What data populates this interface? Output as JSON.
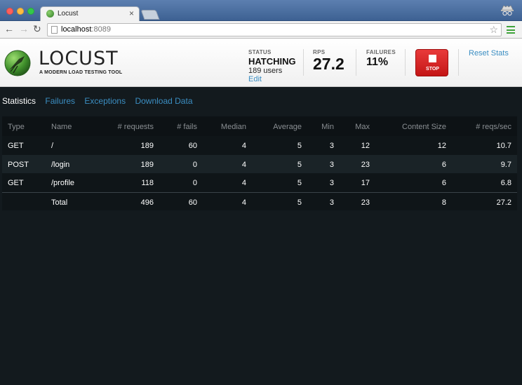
{
  "browser": {
    "tab_title": "Locust",
    "tab_close": "×",
    "url_host": "localhost",
    "url_port": ":8089"
  },
  "app": {
    "logo_text": "LOCUST",
    "logo_subtitle": "A MODERN LOAD TESTING TOOL",
    "status_label": "STATUS",
    "status_value": "HATCHING",
    "users_text": "189 users",
    "edit_label": "Edit",
    "rps_label": "RPS",
    "rps_value": "27.2",
    "failures_label": "FAILURES",
    "failures_value": "11%",
    "stop_label": "STOP",
    "reset_label": "Reset Stats",
    "colors": {
      "accent": "#3b8ec2",
      "stop": "#d42020",
      "background": "#131a1e"
    }
  },
  "tabs": {
    "statistics": "Statistics",
    "failures": "Failures",
    "exceptions": "Exceptions",
    "download": "Download Data"
  },
  "table": {
    "headers": {
      "type": "Type",
      "name": "Name",
      "requests": "# requests",
      "fails": "# fails",
      "median": "Median",
      "average": "Average",
      "min": "Min",
      "max": "Max",
      "content_size": "Content Size",
      "rps": "# reqs/sec"
    },
    "rows": [
      {
        "type": "GET",
        "name": "/",
        "requests": "189",
        "fails": "60",
        "median": "4",
        "average": "5",
        "min": "3",
        "max": "12",
        "content_size": "12",
        "rps": "10.7"
      },
      {
        "type": "POST",
        "name": "/login",
        "requests": "189",
        "fails": "0",
        "median": "4",
        "average": "5",
        "min": "3",
        "max": "23",
        "content_size": "6",
        "rps": "9.7"
      },
      {
        "type": "GET",
        "name": "/profile",
        "requests": "118",
        "fails": "0",
        "median": "4",
        "average": "5",
        "min": "3",
        "max": "17",
        "content_size": "6",
        "rps": "6.8"
      }
    ],
    "total": {
      "type": "",
      "name": "Total",
      "requests": "496",
      "fails": "60",
      "median": "4",
      "average": "5",
      "min": "3",
      "max": "23",
      "content_size": "8",
      "rps": "27.2"
    }
  }
}
